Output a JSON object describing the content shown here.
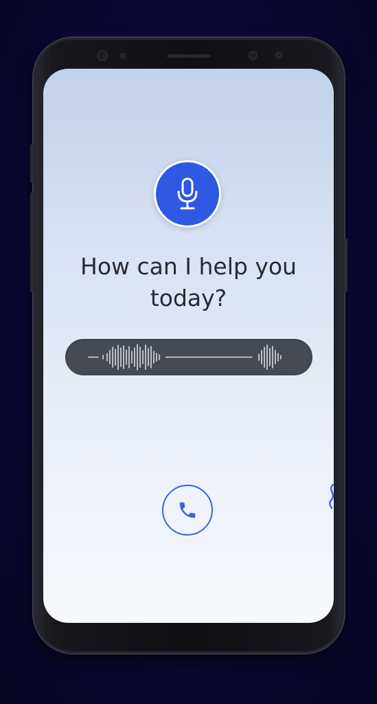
{
  "screen": {
    "prompt_line1": "How can I help you",
    "prompt_line2": "today?"
  },
  "icons": {
    "mic": "microphone-icon",
    "call": "phone-call-icon"
  },
  "colors": {
    "background": "#0b0935",
    "accent_blue": "#2f58e3",
    "waveform_bar": "#464a52",
    "text": "#2a2a30"
  }
}
